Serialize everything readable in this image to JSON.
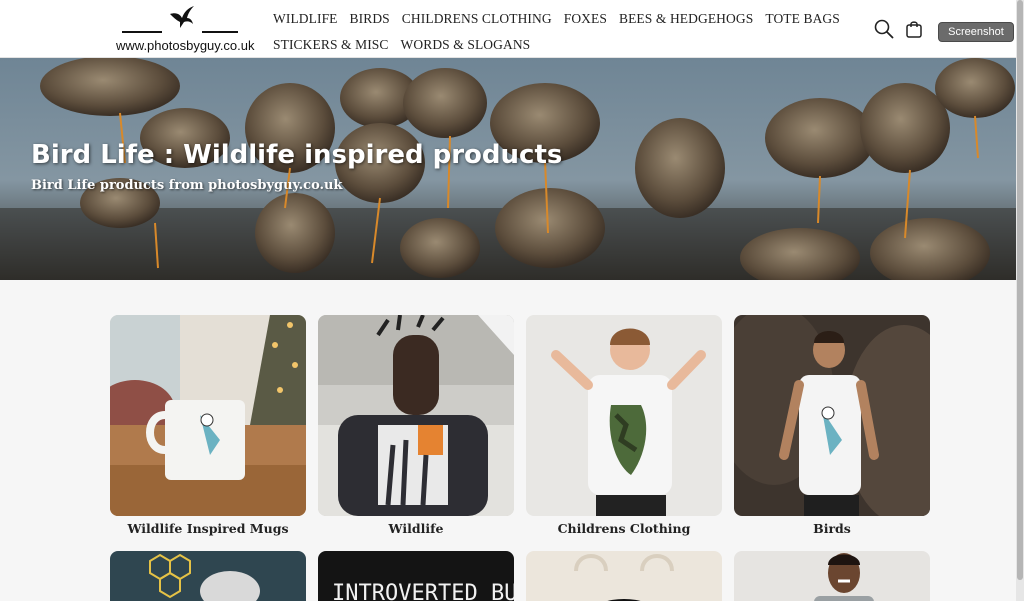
{
  "header": {
    "logo_text": "www.photosbyguy.co.uk",
    "nav_row1": [
      "WILDLIFE",
      "BIRDS",
      "CHILDRENS CLOTHING",
      "FOXES",
      "BEES & HEDGEHOGS",
      "TOTE BAGS"
    ],
    "nav_row2": [
      "STICKERS & MISC",
      "WORDS & SLOGANS"
    ],
    "screenshot_label": "Screenshot"
  },
  "hero": {
    "title": "Bird Life : Wildlife inspired products",
    "subtitle": "Bird Life products from photosbyguy.co.uk"
  },
  "collections": [
    {
      "label": "Wildlife Inspired Mugs"
    },
    {
      "label": "Wildlife"
    },
    {
      "label": "Childrens Clothing"
    },
    {
      "label": "Birds"
    }
  ],
  "second_row_partial_text": "INTROVERTED BUT",
  "colors": {
    "accent_dark": "#111111",
    "screenshot_button": "#6b6b6b",
    "page_bg": "#f6f6f6"
  }
}
